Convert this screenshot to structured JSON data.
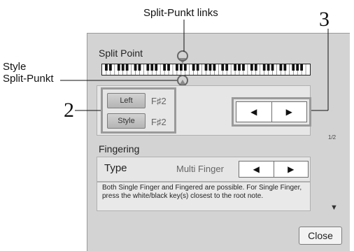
{
  "annotations": {
    "split_left": "Split-Punkt links",
    "style_line1": "Style",
    "style_line2": "Split-Punkt",
    "num_2": "2",
    "num_3": "3"
  },
  "dialog": {
    "split_point_label": "Split Point",
    "left_button": "Left",
    "left_value": "F♯2",
    "style_button": "Style",
    "style_value": "F♯2",
    "page_indicator": "1/2",
    "fingering_label": "Fingering",
    "type_label": "Type",
    "type_value": "Multi Finger",
    "description": "Both Single Finger and Fingered are possible. For Single Finger, press the white/black key(s) closest to the root note.",
    "close_button": "Close"
  },
  "icons": {
    "left_arrow": "◀",
    "right_arrow": "▶",
    "scroll_down": "▼"
  }
}
